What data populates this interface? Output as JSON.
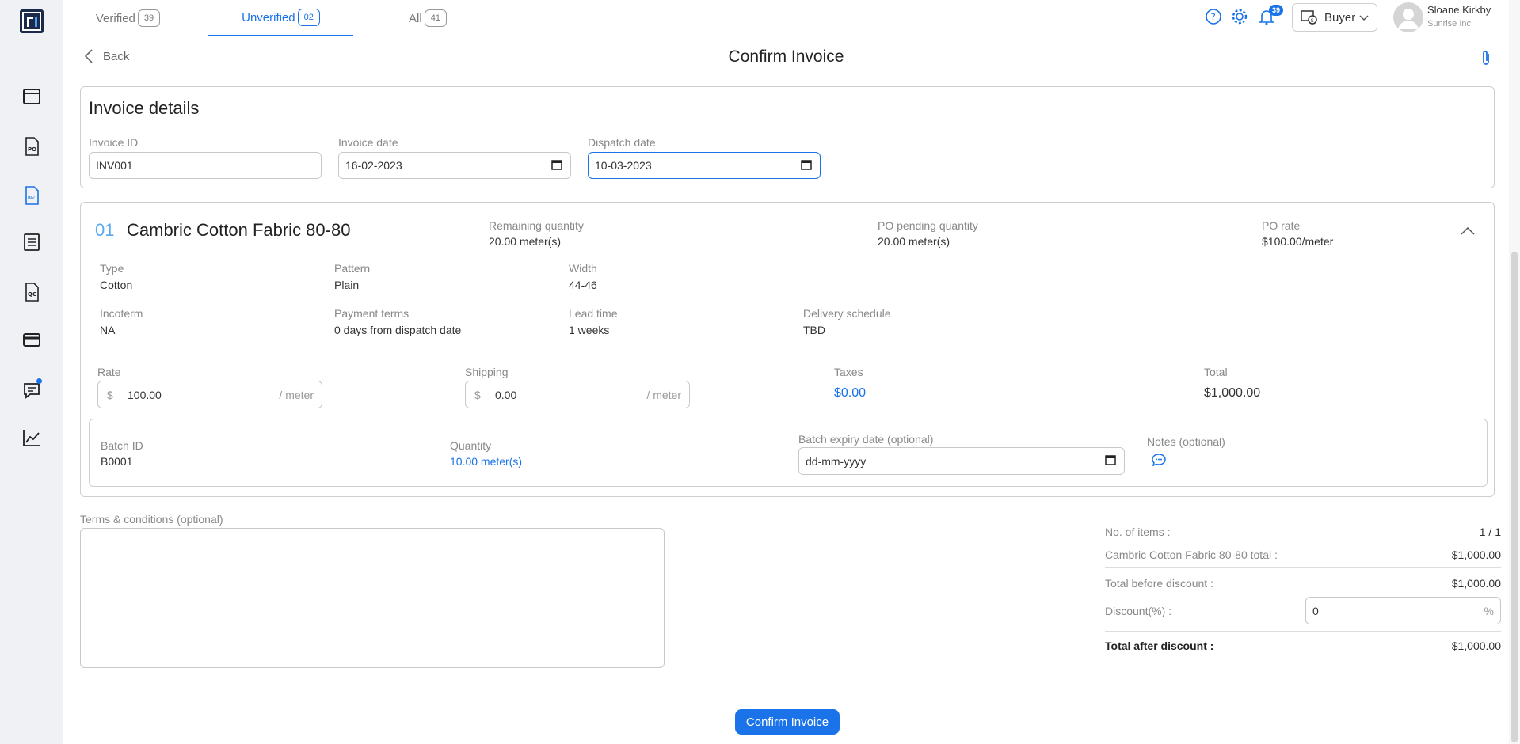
{
  "tabs": [
    {
      "label": "Verified",
      "count": "39"
    },
    {
      "label": "Unverified",
      "count": "02"
    },
    {
      "label": "All",
      "count": "41"
    }
  ],
  "topbar": {
    "notifications_count": "39",
    "role": "Buyer",
    "user_name": "Sloane Kirkby",
    "user_org": "Sunrise Inc"
  },
  "header": {
    "back_label": "Back",
    "title": "Confirm Invoice"
  },
  "invoice_details": {
    "title": "Invoice details",
    "invoice_id_label": "Invoice ID",
    "invoice_id": "INV001",
    "invoice_date_label": "Invoice date",
    "invoice_date": "16-02-2023",
    "dispatch_date_label": "Dispatch date",
    "dispatch_date": "10-03-2023"
  },
  "item": {
    "number": "01",
    "name": "Cambric Cotton Fabric 80-80",
    "remaining_qty_label": "Remaining quantity",
    "remaining_qty": "20.00 meter(s)",
    "po_pending_label": "PO pending quantity",
    "po_pending": "20.00 meter(s)",
    "po_rate_label": "PO rate",
    "po_rate": "$100.00/meter",
    "type_label": "Type",
    "type": "Cotton",
    "pattern_label": "Pattern",
    "pattern": "Plain",
    "width_label": "Width",
    "width": "44-46",
    "incoterm_label": "Incoterm",
    "incoterm": "NA",
    "payment_terms_label": "Payment terms",
    "payment_terms": "0 days from dispatch date",
    "lead_time_label": "Lead time",
    "lead_time": "1 weeks",
    "delivery_label": "Delivery schedule",
    "delivery": "TBD",
    "rate_label": "Rate",
    "rate_prefix": "$",
    "rate": "100.00",
    "rate_suffix": "/ meter",
    "shipping_label": "Shipping",
    "shipping_prefix": "$",
    "shipping": "0.00",
    "shipping_suffix": "/ meter",
    "taxes_label": "Taxes",
    "taxes": "$0.00",
    "total_label": "Total",
    "total": "$1,000.00",
    "batch": {
      "batch_id_label": "Batch ID",
      "batch_id": "B0001",
      "quantity_label": "Quantity",
      "quantity": "10.00 meter(s)",
      "expiry_label": "Batch expiry date (optional)",
      "expiry_placeholder": "dd-mm-yyyy",
      "notes_label": "Notes (optional)"
    }
  },
  "terms": {
    "label": "Terms & conditions (optional)"
  },
  "summary": {
    "items_label": "No. of items :",
    "items_value": "1 / 1",
    "item_total_label": "Cambric Cotton Fabric 80-80 total :",
    "item_total_value": "$1,000.00",
    "before_discount_label": "Total before discount :",
    "before_discount_value": "$1,000.00",
    "discount_label": "Discount(%) :",
    "discount_value": "0",
    "discount_suffix": "%",
    "after_discount_label": "Total after discount :",
    "after_discount_value": "$1,000.00"
  },
  "confirm_button": "Confirm Invoice",
  "colors": {
    "accent": "#1a73e8",
    "logo": "#1b2a4a"
  }
}
